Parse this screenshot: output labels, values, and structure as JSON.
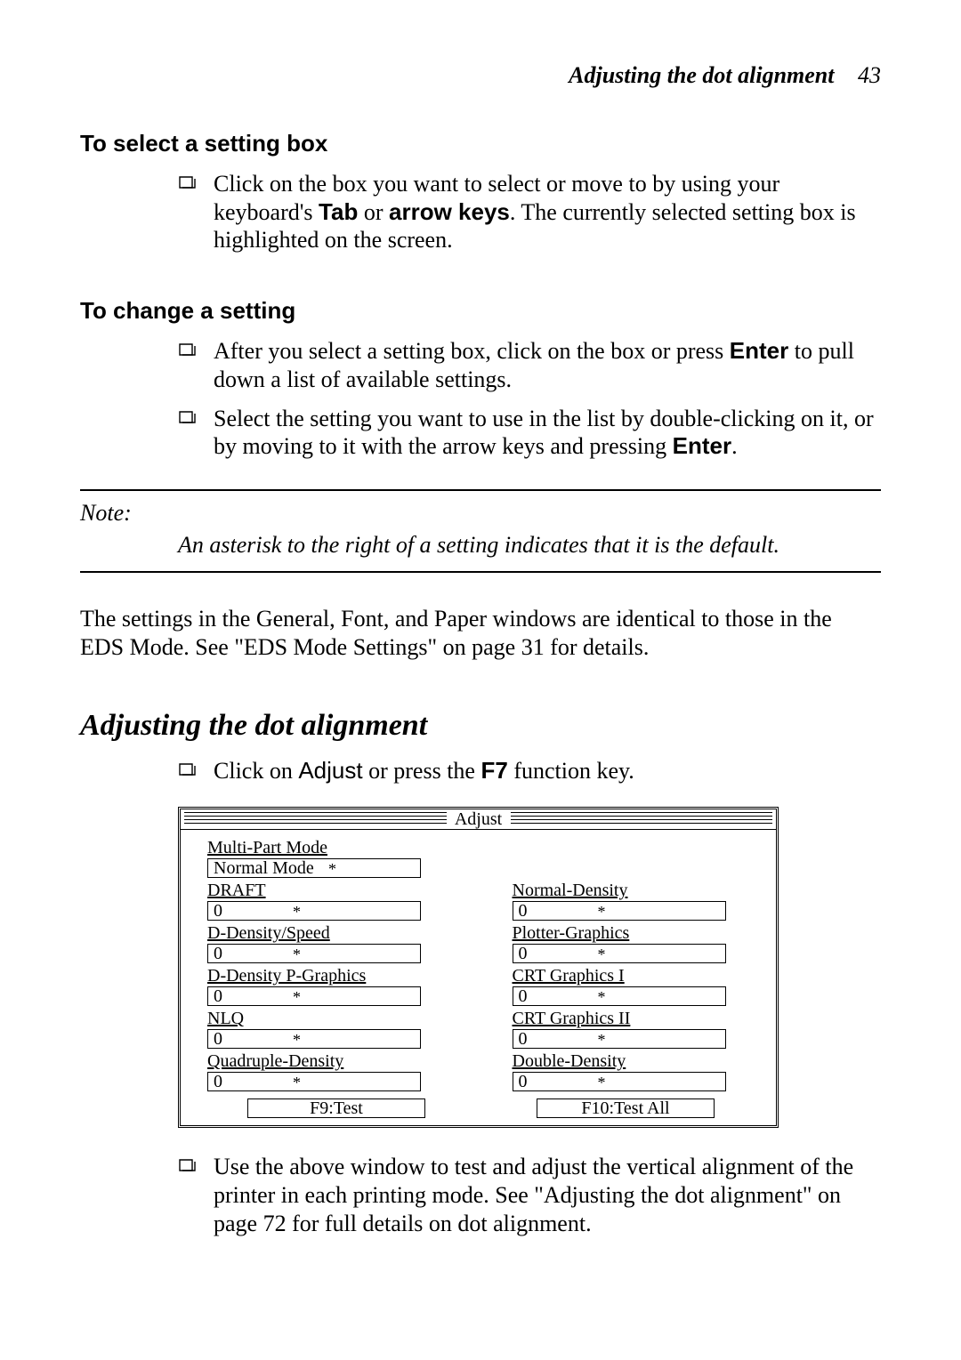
{
  "header": {
    "running_title": "Adjusting the dot alignment",
    "page_number": "43"
  },
  "section1": {
    "heading": "To select a setting box",
    "bullet1_a": "Click on the box you want to select or move to by using your keyboard's ",
    "bullet1_b_bold1": "Tab",
    "bullet1_c": " or ",
    "bullet1_d_bold2": "arrow keys",
    "bullet1_e": ". The currently selected setting box is highlighted on the screen."
  },
  "section2": {
    "heading": "To change a setting",
    "bullet1_a": "After you select a setting box, click on the box or press ",
    "bullet1_b_bold": "Enter",
    "bullet1_c": " to pull down a list of available settings.",
    "bullet2_a": "Select the setting you want to use in the list by double-clicking on it, or by moving to it with the arrow keys and pressing ",
    "bullet2_b_bold": "Enter",
    "bullet2_c": "."
  },
  "note": {
    "label": "Note:",
    "body": "An asterisk to the right of a setting indicates that it is the default."
  },
  "paragraph_after_note": "The settings in the General, Font, and Paper windows are identical to those in the EDS Mode. See \"EDS Mode Settings\" on page 31 for details.",
  "section3": {
    "heading": "Adjusting the dot alignment",
    "bullet1_a": "Click on ",
    "bullet1_b_sans": "Adjust",
    "bullet1_c": " or press the ",
    "bullet1_d_bold": "F7",
    "bullet1_e": " function key.",
    "bullet2": "Use the above window to test and adjust the vertical alignment of the printer in each printing mode. See \"Adjusting the dot alignment\" on page 72 for full details on dot alignment."
  },
  "dialog": {
    "title": "Adjust",
    "left": {
      "multi_part_label": "Multi-Part Mode",
      "multi_part_value": "Normal Mode",
      "draft_label": "DRAFT",
      "draft_value": "0",
      "ddensity_speed_label": "D-Density/Speed",
      "ddensity_speed_value": "0",
      "ddensity_pgraphics_label": "D-Density P-Graphics",
      "ddensity_pgraphics_value": "0",
      "nlq_label": "NLQ",
      "nlq_value": "0",
      "quad_density_label": "Quadruple-Density",
      "quad_density_value": "0"
    },
    "right": {
      "normal_density_label": "Normal-Density",
      "normal_density_value": "0",
      "plotter_graphics_label": "Plotter-Graphics",
      "plotter_graphics_value": "0",
      "crt1_label": "CRT Graphics I",
      "crt1_value": "0",
      "crt2_label": "CRT Graphics II",
      "crt2_value": "0",
      "double_density_label": "Double-Density",
      "double_density_value": "0"
    },
    "asterisk": "*",
    "btn_test": "F9:Test",
    "btn_test_all": "F10:Test All"
  }
}
